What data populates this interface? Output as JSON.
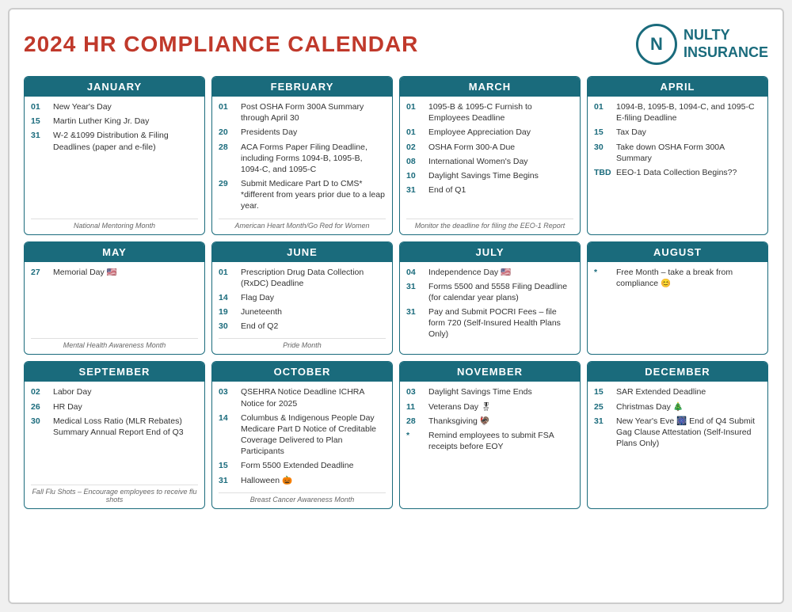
{
  "header": {
    "title": "2024 HR COMPLIANCE CALENDAR",
    "logo_letter": "N",
    "logo_name": "NULTY",
    "logo_sub": "INSURANCE"
  },
  "months": [
    {
      "name": "JANUARY",
      "events": [
        {
          "date": "01",
          "text": "New Year's Day"
        },
        {
          "date": "15",
          "text": "Martin Luther King Jr. Day"
        },
        {
          "date": "31",
          "text": "W-2 &1099 Distribution & Filing Deadlines (paper and e-file)"
        }
      ],
      "footer": "National Mentoring Month"
    },
    {
      "name": "FEBRUARY",
      "events": [
        {
          "date": "01",
          "text": "Post OSHA Form 300A Summary through April 30"
        },
        {
          "date": "20",
          "text": "Presidents Day"
        },
        {
          "date": "28",
          "text": "ACA Forms Paper Filing Deadline, including Forms 1094-B, 1095-B, 1094-C, and 1095-C"
        },
        {
          "date": "29",
          "text": "Submit Medicare Part D to CMS*\n*different from years prior due to a leap year."
        }
      ],
      "footer": "American Heart Month/Go Red for Women"
    },
    {
      "name": "MARCH",
      "events": [
        {
          "date": "01",
          "text": "1095-B & 1095-C Furnish to Employees Deadline"
        },
        {
          "date": "01",
          "text": "Employee Appreciation Day"
        },
        {
          "date": "02",
          "text": "OSHA Form 300-A Due"
        },
        {
          "date": "08",
          "text": "International Women's Day"
        },
        {
          "date": "10",
          "text": "Daylight Savings Time Begins"
        },
        {
          "date": "31",
          "text": "End of Q1"
        }
      ],
      "footer": "Monitor the deadline for filing the EEO-1 Report"
    },
    {
      "name": "APRIL",
      "events": [
        {
          "date": "01",
          "text": "1094-B, 1095-B, 1094-C, and 1095-C E-filing Deadline"
        },
        {
          "date": "15",
          "text": "Tax Day"
        },
        {
          "date": "30",
          "text": "Take down OSHA Form 300A Summary"
        },
        {
          "date": "TBD",
          "text": "EEO-1 Data Collection Begins??"
        }
      ],
      "footer": ""
    },
    {
      "name": "MAY",
      "events": [
        {
          "date": "27",
          "text": "Memorial Day 🇺🇸"
        }
      ],
      "footer": "Mental Health Awareness Month"
    },
    {
      "name": "JUNE",
      "events": [
        {
          "date": "01",
          "text": "Prescription Drug Data Collection (RxDC) Deadline"
        },
        {
          "date": "14",
          "text": "Flag Day"
        },
        {
          "date": "19",
          "text": "Juneteenth"
        },
        {
          "date": "30",
          "text": "End of Q2"
        }
      ],
      "footer": "Pride Month"
    },
    {
      "name": "JULY",
      "events": [
        {
          "date": "04",
          "text": "Independence Day 🇺🇸"
        },
        {
          "date": "31",
          "text": "Forms 5500 and 5558 Filing Deadline (for calendar year plans)"
        },
        {
          "date": "31",
          "text": "Pay and Submit POCRI Fees – file form 720 (Self-Insured Health Plans Only)"
        }
      ],
      "footer": ""
    },
    {
      "name": "AUGUST",
      "events": [
        {
          "date": "*",
          "text": "Free Month – take a break from compliance 😊"
        }
      ],
      "footer": ""
    },
    {
      "name": "SEPTEMBER",
      "events": [
        {
          "date": "02",
          "text": "Labor Day"
        },
        {
          "date": "26",
          "text": "HR Day"
        },
        {
          "date": "30",
          "text": "Medical Loss Ratio (MLR Rebates) Summary Annual Report\nEnd of Q3"
        }
      ],
      "footer": "Fall Flu Shots – Encourage employees to receive flu shots"
    },
    {
      "name": "OCTOBER",
      "events": [
        {
          "date": "03",
          "text": "QSEHRA Notice Deadline\nICHRA Notice for 2025"
        },
        {
          "date": "14",
          "text": "Columbus & Indigenous People Day\nMedicare Part D Notice of Creditable Coverage Delivered to Plan Participants"
        },
        {
          "date": "15",
          "text": "Form 5500 Extended Deadline"
        },
        {
          "date": "31",
          "text": "Halloween 🎃"
        }
      ],
      "footer": "Breast Cancer Awareness Month"
    },
    {
      "name": "NOVEMBER",
      "events": [
        {
          "date": "03",
          "text": "Daylight Savings Time Ends"
        },
        {
          "date": "11",
          "text": "Veterans Day 🎖"
        },
        {
          "date": "28",
          "text": "Thanksgiving 🦃"
        },
        {
          "date": "*",
          "text": "Remind employees to submit FSA receipts before EOY"
        }
      ],
      "footer": ""
    },
    {
      "name": "DECEMBER",
      "events": [
        {
          "date": "15",
          "text": "SAR Extended Deadline"
        },
        {
          "date": "25",
          "text": "Christmas Day 🎄"
        },
        {
          "date": "31",
          "text": "New Year's Eve 🎆\nEnd of Q4\nSubmit Gag Clause Attestation (Self-Insured Plans Only)"
        }
      ],
      "footer": ""
    }
  ]
}
